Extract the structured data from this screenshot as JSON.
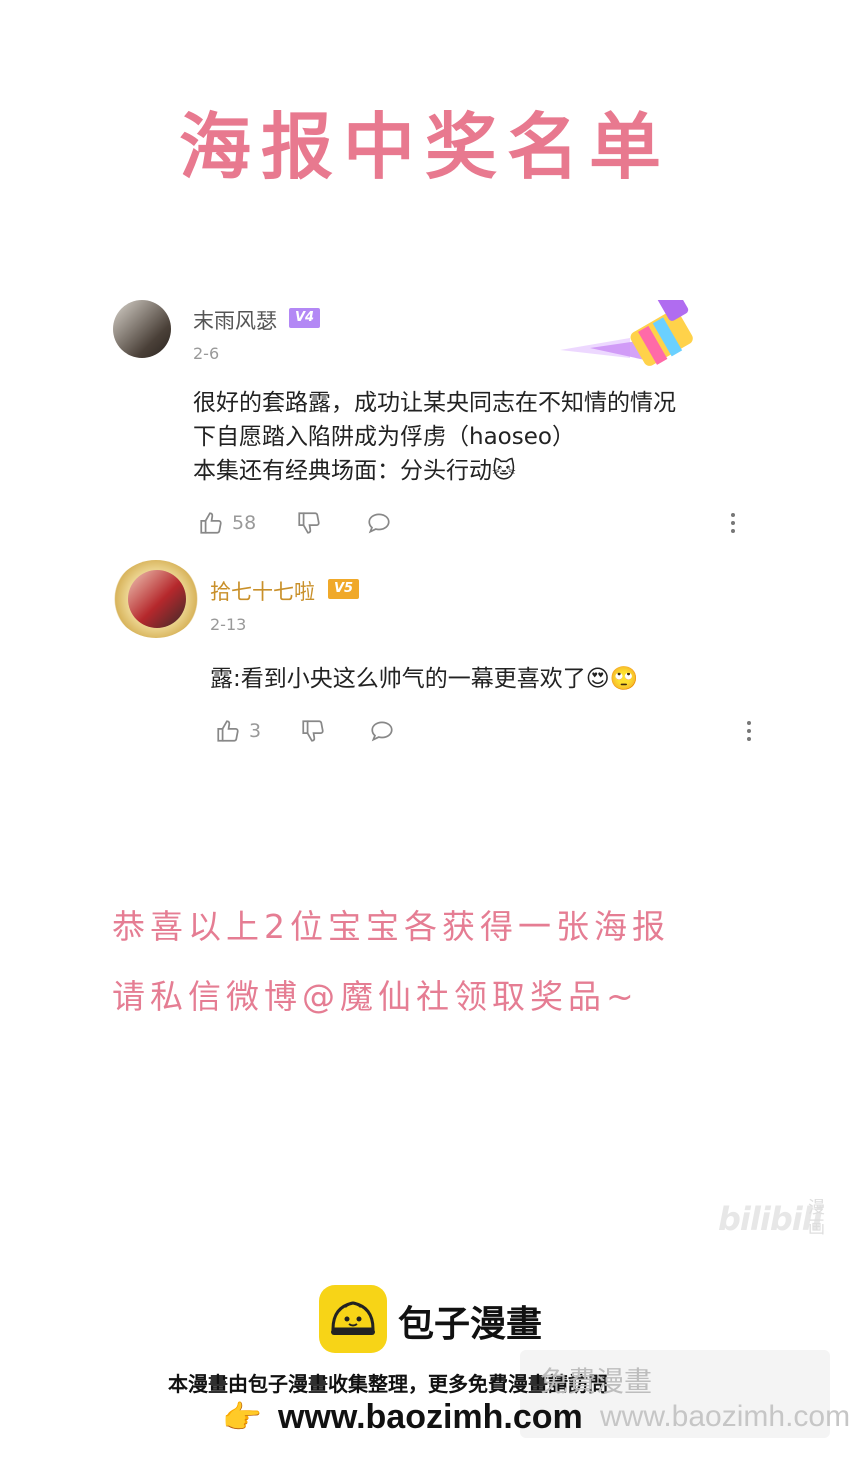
{
  "title": "海报中奖名单",
  "comments": [
    {
      "username": "末雨风瑟",
      "level": "V4",
      "date": "2-6",
      "text_lines": [
        "很好的套路露，成功让某央同志在不知情的情况",
        "下自愿踏入陷阱成为俘虏（haoseo）",
        "本集还有经典场面：分头行动🐱"
      ],
      "likes": "58"
    },
    {
      "username": "拾七十七啦",
      "level": "V5",
      "date": "2-13",
      "text": "露:看到小央这么帅气的一幕更喜欢了😍🙄",
      "likes": "3"
    }
  ],
  "announce": {
    "line1": "恭喜以上2位宝宝各获得一张海报",
    "line2": "请私信微博@魔仙社领取奖品~"
  },
  "watermark": {
    "bili": "bilibili",
    "bili_sub": "漫画"
  },
  "footer": {
    "brand": "包子漫畫",
    "line": "本漫畫由包子漫畫收集整理，更多免費漫畫請訪問",
    "url": "www.baozimh.com",
    "wm_line1": "免費漫畫",
    "wm_line2": "www.baozimh.com"
  },
  "colors": {
    "title": "#e8798f",
    "v4": "#b388f5",
    "v5": "#f0a92a",
    "username2": "#c9902a"
  }
}
